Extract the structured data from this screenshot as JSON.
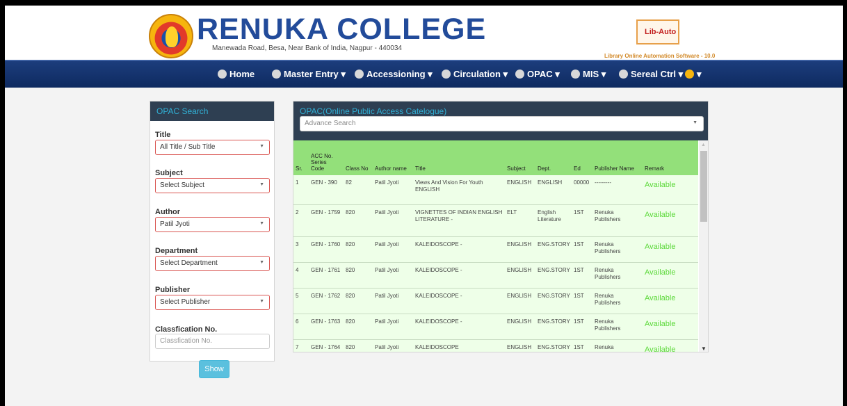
{
  "header": {
    "college_name": "RENUKA COLLEGE",
    "address": "Manewada Road, Besa, Near Bank of India, Nagpur - 440034",
    "libauto_label": "Lib-Auto",
    "libauto_tagline": "Library Online Automation Software - 10.0"
  },
  "nav": {
    "items": [
      {
        "label": "Home",
        "icon": "home-icon"
      },
      {
        "label": "Master Entry ▾",
        "icon": "edit-icon"
      },
      {
        "label": "Accessioning ▾",
        "icon": "list-icon"
      },
      {
        "label": "Circulation ▾",
        "icon": "list-icon"
      },
      {
        "label": "OPAC ▾",
        "icon": "list-icon"
      },
      {
        "label": "MIS ▾",
        "icon": "list-icon"
      },
      {
        "label": "Sereal Ctrl ▾",
        "icon": "list-icon"
      },
      {
        "label": "▾",
        "icon": "user-avatar-icon"
      }
    ]
  },
  "search_panel": {
    "title": "OPAC Search",
    "fields": [
      {
        "label": "Title",
        "value": "All Title / Sub Title"
      },
      {
        "label": "Subject",
        "value": "Select Subject"
      },
      {
        "label": "Author",
        "value": "Patil Jyoti"
      },
      {
        "label": "Department",
        "value": "Select Department"
      },
      {
        "label": "Publisher",
        "value": "Select Publisher"
      }
    ],
    "class_label": "Classfication No.",
    "class_placeholder": "Classfication No.",
    "show_label": "Show"
  },
  "results_panel": {
    "title": "OPAC(Online Public Access Catelogue)",
    "advance_search_placeholder": "Advance Search",
    "columns": [
      "Sr.",
      "ACC No. Series Code",
      "Class No",
      "Author name",
      "Title",
      "Subject",
      "Dept.",
      "Ed",
      "Publisher Name",
      "Remark"
    ],
    "rows": [
      [
        "1",
        "GEN - 390",
        "82",
        "Patil Jyoti",
        "Views And Vision For Youth ENGLISH",
        "ENGLISH",
        "ENGLISH",
        "00000",
        "---------",
        "Available"
      ],
      [
        "2",
        "GEN - 1759",
        "820",
        "Patil Jyoti",
        "VIGNETTES OF INDIAN ENGLISH LITERATURE -",
        "ELT",
        "English Literature",
        "1ST",
        "Renuka Publishers",
        "Available"
      ],
      [
        "3",
        "GEN - 1760",
        "820",
        "Patil Jyoti",
        "KALEIDOSCOPE -",
        "ENGLISH",
        "ENG.STORY",
        "1ST",
        "Renuka Publishers",
        "Available"
      ],
      [
        "4",
        "GEN - 1761",
        "820",
        "Patil Jyoti",
        "KALEIDOSCOPE -",
        "ENGLISH",
        "ENG.STORY",
        "1ST",
        "Renuka Publishers",
        "Available"
      ],
      [
        "5",
        "GEN - 1762",
        "820",
        "Patil Jyoti",
        "KALEIDOSCOPE -",
        "ENGLISH",
        "ENG.STORY",
        "1ST",
        "Renuka Publishers",
        "Available"
      ],
      [
        "6",
        "GEN - 1763",
        "820",
        "Patil Jyoti",
        "KALEIDOSCOPE -",
        "ENGLISH",
        "ENG.STORY",
        "1ST",
        "Renuka Publishers",
        "Available"
      ],
      [
        "7",
        "GEN - 1764",
        "820",
        "Patil Jyoti",
        "KALEIDOSCOPE",
        "ENGLISH",
        "ENG.STORY",
        "1ST",
        "Renuka Publishers",
        "Available"
      ]
    ]
  },
  "colors": {
    "brand_blue": "#224b9a",
    "navbar": "#1c3d7c",
    "panel_header": "#2e3f52",
    "accent_cyan": "#31b0d5",
    "table_header_green": "#93e07a",
    "row_bg": "#eeffe8",
    "available_green": "#5cd93a",
    "field_border_red": "#d9534f"
  }
}
